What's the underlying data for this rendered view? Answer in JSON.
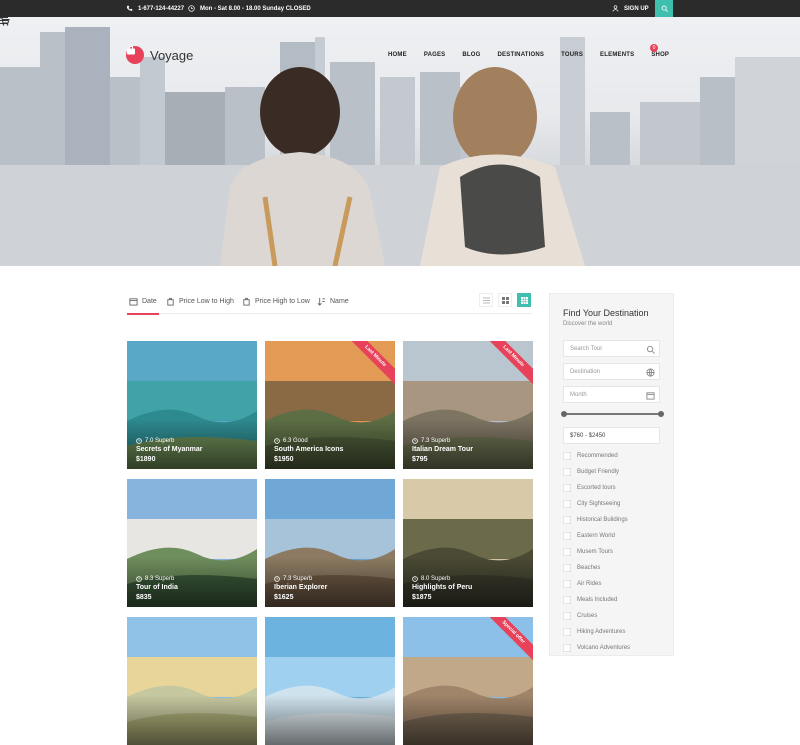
{
  "topbar": {
    "phone": "1-677-124-44227",
    "hours": "Mon - Sat 8.00 - 18.00 Sunday CLOSED",
    "signup": "SIGN UP"
  },
  "brand": {
    "name": "Voyage",
    "accent": "#e8425a",
    "teal": "#3fbfad"
  },
  "nav": {
    "items": [
      "HOME",
      "PAGES",
      "BLOG",
      "DESTINATIONS",
      "TOURS",
      "ELEMENTS",
      "SHOP"
    ],
    "cart_count": "0"
  },
  "sort": {
    "options": [
      "Date",
      "Price Low to High",
      "Price High to Low",
      "Name"
    ],
    "active": "Date"
  },
  "tours": [
    {
      "rating": "7.0 Superb",
      "title": "Secrets of Myanmar",
      "price": "$1890",
      "ribbon": ""
    },
    {
      "rating": "6.3 Good",
      "title": "South America Icons",
      "price": "$1950",
      "ribbon": "Last Minute"
    },
    {
      "rating": "7.3 Superb",
      "title": "Italian Dream Tour",
      "price": "$795",
      "ribbon": "Last Minute"
    },
    {
      "rating": "8.3 Superb",
      "title": "Tour of India",
      "price": "$835",
      "ribbon": ""
    },
    {
      "rating": "7.3 Superb",
      "title": "Iberian Explorer",
      "price": "$1625",
      "ribbon": ""
    },
    {
      "rating": "8.0 Superb",
      "title": "Highlights of Peru",
      "price": "$1875",
      "ribbon": ""
    },
    {
      "rating": "",
      "title": "",
      "price": "",
      "ribbon": ""
    },
    {
      "rating": "",
      "title": "",
      "price": "",
      "ribbon": ""
    },
    {
      "rating": "",
      "title": "",
      "price": "",
      "ribbon": "Special offer"
    }
  ],
  "sidebar": {
    "title": "Find Your Destination",
    "subtitle": "Discover the world",
    "search_placeholder": "Search Tour",
    "destination_placeholder": "Destination",
    "month_placeholder": "Month",
    "price_range": "$760 - $2450",
    "categories": [
      "Recommended",
      "Budget Friendly",
      "Escorted tours",
      "City Sightseeing",
      "Historical Buildings",
      "Eastern World",
      "Musem Tours",
      "Beaches",
      "Air Rides",
      "Meals Included",
      "Cruises",
      "Hiking Adventures",
      "Volcano Adventures"
    ]
  }
}
